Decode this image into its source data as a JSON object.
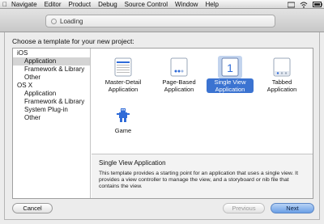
{
  "menubar": {
    "items": [
      "Navigate",
      "Editor",
      "Product",
      "Debug",
      "Source Control",
      "Window",
      "Help"
    ]
  },
  "toolbar": {
    "activity_text": "Loading"
  },
  "sheet": {
    "title": "Choose a template for your new project:",
    "sidebar": {
      "ios_header": "iOS",
      "ios_items": [
        "Application",
        "Framework & Library",
        "Other"
      ],
      "osx_header": "OS X",
      "osx_items": [
        "Application",
        "Framework & Library",
        "System Plug-in",
        "Other"
      ]
    },
    "templates": [
      {
        "label": "Master-Detail Application",
        "icon": "master-detail-icon"
      },
      {
        "label": "Page-Based Application",
        "icon": "page-based-icon"
      },
      {
        "label": "Single View Application",
        "icon": "single-view-icon",
        "selected": true
      },
      {
        "label": "Tabbed Application",
        "icon": "tabbed-icon"
      },
      {
        "label": "Game",
        "icon": "game-icon"
      }
    ],
    "description": {
      "title": "Single View Application",
      "body": "This template provides a starting point for an application that uses a single view. It provides a view controller to manage the view, and a storyboard or nib file that contains the view."
    },
    "buttons": {
      "cancel": "Cancel",
      "previous": "Previous",
      "next": "Next"
    }
  },
  "colors": {
    "selection_blue": "#3b73d1",
    "icon_blue": "#2f6bd8"
  }
}
